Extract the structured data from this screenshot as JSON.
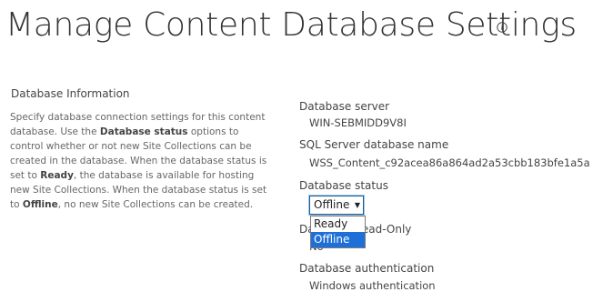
{
  "page": {
    "title": "Manage Content Database Settings",
    "info_icon": "info-circle-icon"
  },
  "section": {
    "heading": "Database Information",
    "description": {
      "p1": "Specify database connection settings for this content database. Use the ",
      "b1": "Database status",
      "p2": " options to control whether or not new Site Collections can be created in the database. When the database status is set to ",
      "b2": "Ready",
      "p3": ", the database is available for hosting new Site Collections. When the database status is set to ",
      "b3": "Offline",
      "p4": ", no new Site Collections can be created."
    }
  },
  "fields": {
    "server_label": "Database server",
    "server_value": "WIN-SEBMIDD9V8I",
    "sql_name_label": "SQL Server database name",
    "sql_name_value": "WSS_Content_c92acea86a864ad2a53cbb183bfe1a5a",
    "status_label": "Database status",
    "status_selected": "Offline",
    "status_options": [
      "Ready",
      "Offline"
    ],
    "read_only_label": "Database Read-Only",
    "read_only_value": "No",
    "auth_label": "Database authentication",
    "auth_value": "Windows authentication"
  },
  "colors": {
    "selected_option_bg": "#1e70d8",
    "select_border": "#1a5e96"
  }
}
